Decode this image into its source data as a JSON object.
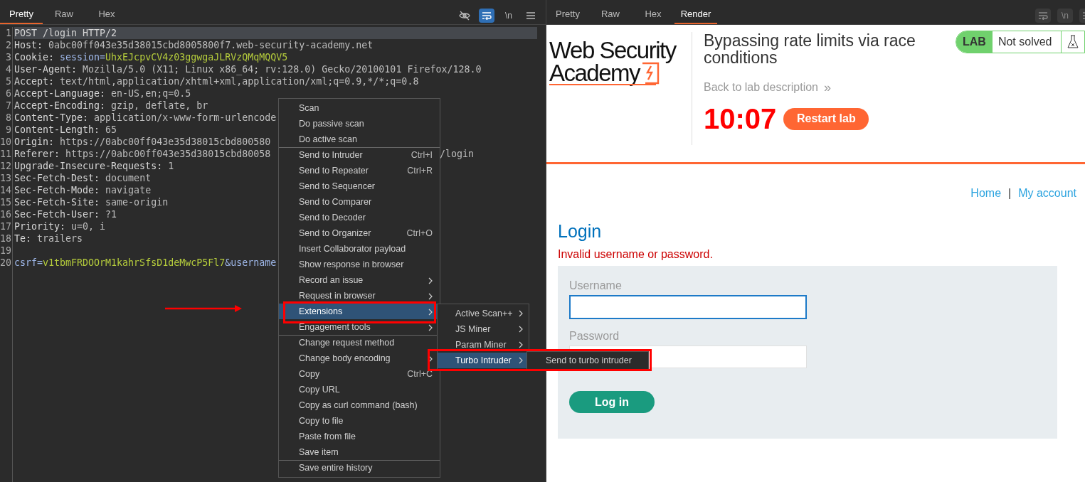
{
  "request": {
    "tabs": [
      {
        "label": "Pretty",
        "selected": true
      },
      {
        "label": "Raw",
        "selected": false
      },
      {
        "label": "Hex",
        "selected": false
      }
    ],
    "toolbar": [
      {
        "kind": "hide",
        "active": false
      },
      {
        "kind": "wrap",
        "active": true
      },
      {
        "kind": "text",
        "label": "\\n",
        "active": false
      },
      {
        "kind": "menu",
        "active": false
      }
    ],
    "lines": [
      {
        "number": "1",
        "highlighted": true,
        "segments": [
          {
            "kind": "plain",
            "text": "POST /login HTTP/2"
          }
        ]
      },
      {
        "number": "2",
        "highlighted": false,
        "segments": [
          {
            "kind": "name",
            "text": "Host: "
          },
          {
            "kind": "value",
            "text": "0abc00ff043e35d38015cbd8005800f7.web-security-academy.net"
          }
        ]
      },
      {
        "number": "3",
        "highlighted": false,
        "segments": [
          {
            "kind": "name",
            "text": "Cookie: "
          },
          {
            "kind": "param",
            "text": "session="
          },
          {
            "kind": "paramvalue",
            "text": "UhxEJcpvCV4z03ggwgaJLRVzQMqMQQV5"
          }
        ]
      },
      {
        "number": "4",
        "highlighted": false,
        "segments": [
          {
            "kind": "name",
            "text": "User-Agent: "
          },
          {
            "kind": "value",
            "text": "Mozilla/5.0 (X11; Linux x86_64; rv:128.0) Gecko/20100101 Firefox/128.0"
          }
        ]
      },
      {
        "number": "5",
        "highlighted": false,
        "segments": [
          {
            "kind": "name",
            "text": "Accept: "
          },
          {
            "kind": "value",
            "text": "text/html,application/xhtml+xml,application/xml;q=0.9,*/*;q=0.8"
          }
        ]
      },
      {
        "number": "6",
        "highlighted": false,
        "segments": [
          {
            "kind": "name",
            "text": "Accept-Language: "
          },
          {
            "kind": "value",
            "text": "en-US,en;q=0.5"
          }
        ]
      },
      {
        "number": "7",
        "highlighted": false,
        "segments": [
          {
            "kind": "name",
            "text": "Accept-Encoding: "
          },
          {
            "kind": "value",
            "text": "gzip, deflate, br"
          }
        ]
      },
      {
        "number": "8",
        "highlighted": false,
        "segments": [
          {
            "kind": "name",
            "text": "Content-Type: "
          },
          {
            "kind": "value",
            "text": "application/x-www-form-urlencode"
          }
        ]
      },
      {
        "number": "9",
        "highlighted": false,
        "segments": [
          {
            "kind": "name",
            "text": "Content-Length: "
          },
          {
            "kind": "value",
            "text": "65"
          }
        ]
      },
      {
        "number": "10",
        "highlighted": false,
        "segments": [
          {
            "kind": "name",
            "text": "Origin: "
          },
          {
            "kind": "value",
            "text": "https://0abc00ff043e35d38015cbd800580"
          }
        ]
      },
      {
        "number": "11",
        "highlighted": false,
        "segments": [
          {
            "kind": "name",
            "text": "Referer: "
          },
          {
            "kind": "value",
            "text": "https://0abc00ff043e35d38015cbd80058"
          }
        ],
        "tail": "/login"
      },
      {
        "number": "12",
        "highlighted": false,
        "segments": [
          {
            "kind": "name",
            "text": "Upgrade-Insecure-Requests: "
          },
          {
            "kind": "value",
            "text": "1"
          }
        ]
      },
      {
        "number": "13",
        "highlighted": false,
        "segments": [
          {
            "kind": "name",
            "text": "Sec-Fetch-Dest: "
          },
          {
            "kind": "value",
            "text": "document"
          }
        ]
      },
      {
        "number": "14",
        "highlighted": false,
        "segments": [
          {
            "kind": "name",
            "text": "Sec-Fetch-Mode: "
          },
          {
            "kind": "value",
            "text": "navigate"
          }
        ]
      },
      {
        "number": "15",
        "highlighted": false,
        "segments": [
          {
            "kind": "name",
            "text": "Sec-Fetch-Site: "
          },
          {
            "kind": "value",
            "text": "same-origin"
          }
        ]
      },
      {
        "number": "16",
        "highlighted": false,
        "segments": [
          {
            "kind": "name",
            "text": "Sec-Fetch-User: "
          },
          {
            "kind": "value",
            "text": "?1"
          }
        ]
      },
      {
        "number": "17",
        "highlighted": false,
        "segments": [
          {
            "kind": "name",
            "text": "Priority: "
          },
          {
            "kind": "value",
            "text": "u=0, i"
          }
        ]
      },
      {
        "number": "18",
        "highlighted": false,
        "segments": [
          {
            "kind": "name",
            "text": "Te: "
          },
          {
            "kind": "value",
            "text": "trailers"
          }
        ]
      },
      {
        "number": "19",
        "highlighted": false
      },
      {
        "number": "20",
        "highlighted": false,
        "segments": [
          {
            "kind": "param",
            "text": "csrf="
          },
          {
            "kind": "paramvalue",
            "text": "v1tbmFRDOOrM1kahrSfsD1deMwcP5Fl7"
          },
          {
            "kind": "param",
            "text": "&username"
          }
        ]
      }
    ]
  },
  "context_menu": {
    "items": [
      {
        "label": "Scan",
        "separator_before": false,
        "submenu": false,
        "selected": false
      },
      {
        "label": "Do passive scan",
        "separator_before": false,
        "submenu": false,
        "selected": false
      },
      {
        "label": "Do active scan",
        "separator_before": false,
        "submenu": false,
        "selected": false
      },
      {
        "label": "Send to Intruder",
        "shortcut": "Ctrl+I",
        "separator_before": true,
        "submenu": false,
        "selected": false
      },
      {
        "label": "Send to Repeater",
        "shortcut": "Ctrl+R",
        "separator_before": false,
        "submenu": false,
        "selected": false
      },
      {
        "label": "Send to Sequencer",
        "separator_before": false,
        "submenu": false,
        "selected": false
      },
      {
        "label": "Send to Comparer",
        "separator_before": false,
        "submenu": false,
        "selected": false
      },
      {
        "label": "Send to Decoder",
        "separator_before": false,
        "submenu": false,
        "selected": false
      },
      {
        "label": "Send to Organizer",
        "shortcut": "Ctrl+O",
        "separator_before": false,
        "submenu": false,
        "selected": false
      },
      {
        "label": "Insert Collaborator payload",
        "separator_before": false,
        "submenu": false,
        "selected": false
      },
      {
        "label": "Show response in browser",
        "separator_before": false,
        "submenu": false,
        "selected": false
      },
      {
        "label": "Record an issue",
        "separator_before": false,
        "submenu": true,
        "selected": false
      },
      {
        "label": "Request in browser",
        "separator_before": false,
        "submenu": true,
        "selected": false
      },
      {
        "label": "Extensions",
        "separator_before": false,
        "submenu": true,
        "selected": true
      },
      {
        "label": "Engagement tools",
        "separator_before": false,
        "submenu": true,
        "selected": false
      },
      {
        "label": "Change request method",
        "separator_before": true,
        "submenu": false,
        "selected": false
      },
      {
        "label": "Change body encoding",
        "separator_before": false,
        "submenu": true,
        "selected": false
      },
      {
        "label": "Copy",
        "shortcut": "Ctrl+C",
        "separator_before": false,
        "submenu": false,
        "selected": false
      },
      {
        "label": "Copy URL",
        "separator_before": false,
        "submenu": false,
        "selected": false
      },
      {
        "label": "Copy as curl command (bash)",
        "separator_before": false,
        "submenu": false,
        "selected": false
      },
      {
        "label": "Copy to file",
        "separator_before": false,
        "submenu": false,
        "selected": false
      },
      {
        "label": "Paste from file",
        "separator_before": false,
        "submenu": false,
        "selected": false
      },
      {
        "label": "Save item",
        "separator_before": false,
        "submenu": false,
        "selected": false
      },
      {
        "label": "Save entire history",
        "separator_before": true,
        "submenu": false,
        "selected": false
      }
    ],
    "extensions_submenu": [
      {
        "label": "Active Scan++",
        "submenu": true,
        "selected": false
      },
      {
        "label": "JS Miner",
        "submenu": true,
        "selected": false
      },
      {
        "label": "Param Miner",
        "submenu": true,
        "selected": false
      },
      {
        "label": "Turbo Intruder",
        "submenu": true,
        "selected": true
      }
    ],
    "turbo_submenu": [
      {
        "label": "Send to turbo intruder",
        "selected": false
      }
    ]
  },
  "response": {
    "tabs": [
      {
        "label": "Pretty",
        "selected": false
      },
      {
        "label": "Raw",
        "selected": false
      },
      {
        "label": "Hex",
        "selected": false
      },
      {
        "label": "Render",
        "selected": true
      }
    ],
    "toolbar": [
      {
        "kind": "wrap",
        "active": false
      },
      {
        "kind": "text",
        "label": "\\n",
        "active": false
      },
      {
        "kind": "menu",
        "active": false
      }
    ],
    "page": {
      "logo": {
        "line_1": "Web Security",
        "line_2": "Academy"
      },
      "lab_title": "Bypassing rate limits via race conditions",
      "lab_badge": {
        "label": "LAB",
        "status": "Not solved",
        "solved": false
      },
      "back_link": "Back to lab description",
      "back_link_icon": "»",
      "timer": "10:07",
      "restart_button": "Restart lab",
      "nav": [
        {
          "label": "Home"
        },
        {
          "label": "|",
          "kind": "separator"
        },
        {
          "label": "My account"
        }
      ],
      "heading": "Login",
      "error": "Invalid username or password.",
      "form": {
        "fields": [
          {
            "label": "Username",
            "focused": true
          },
          {
            "label": "Password",
            "focused": false
          }
        ],
        "submit": "Log in"
      }
    }
  }
}
